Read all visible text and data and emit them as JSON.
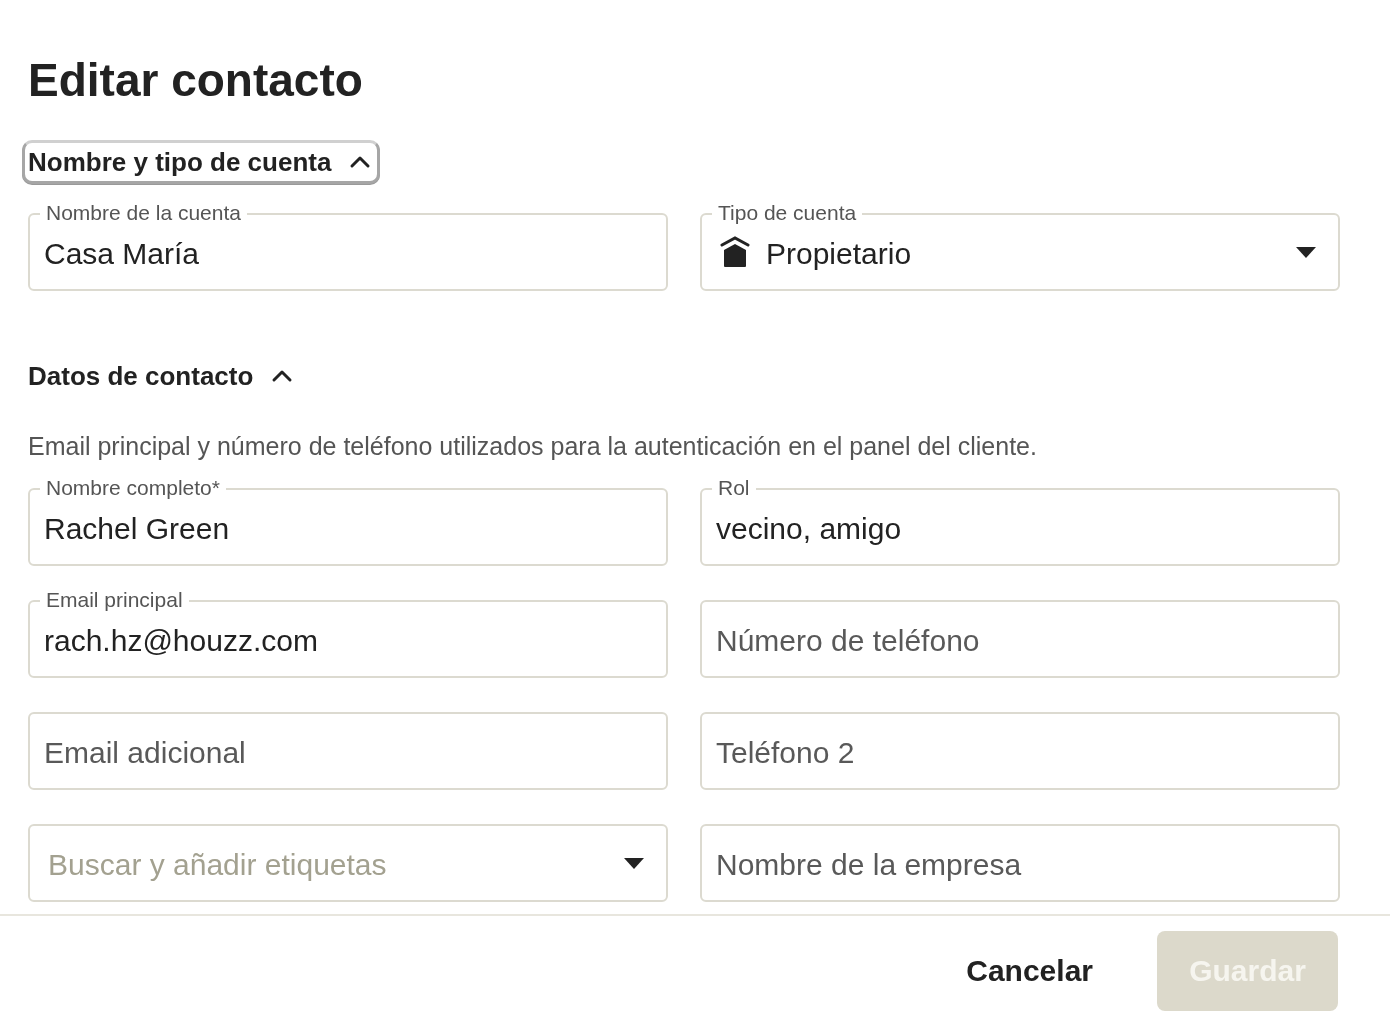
{
  "title": "Editar contacto",
  "sections": [
    {
      "title": "Nombre y tipo de cuenta",
      "expanded": true,
      "focused": true,
      "fields": [
        {
          "kind": "text",
          "label": "Nombre de la cuenta",
          "value": "Casa María"
        },
        {
          "kind": "icon-select",
          "label": "Tipo de cuenta",
          "value": "Propietario"
        }
      ]
    },
    {
      "title": "Datos de contacto",
      "expanded": true,
      "focused": false,
      "description": "Email principal y número de teléfono utilizados para la autenticación en el panel del cliente.",
      "fields": [
        {
          "kind": "text",
          "label": "Nombre completo*",
          "value": "Rachel Green"
        },
        {
          "kind": "text",
          "label": "Rol",
          "value": "vecino, amigo"
        },
        {
          "kind": "text",
          "label": "Email principal",
          "value": "rach.hz@houzz.com"
        },
        {
          "kind": "text",
          "placeholder": "Número de teléfono"
        },
        {
          "kind": "text",
          "placeholder": "Email adicional"
        },
        {
          "kind": "text",
          "placeholder": "Teléfono 2"
        },
        {
          "kind": "select",
          "placeholder": "Buscar y añadir etiquetas"
        },
        {
          "kind": "text",
          "placeholder": "Nombre de la empresa"
        }
      ]
    }
  ],
  "buttons": [
    {
      "label": "Cancelar",
      "kind": "text",
      "disabled": false
    },
    {
      "label": "Guardar",
      "kind": "primary",
      "disabled": true
    }
  ]
}
